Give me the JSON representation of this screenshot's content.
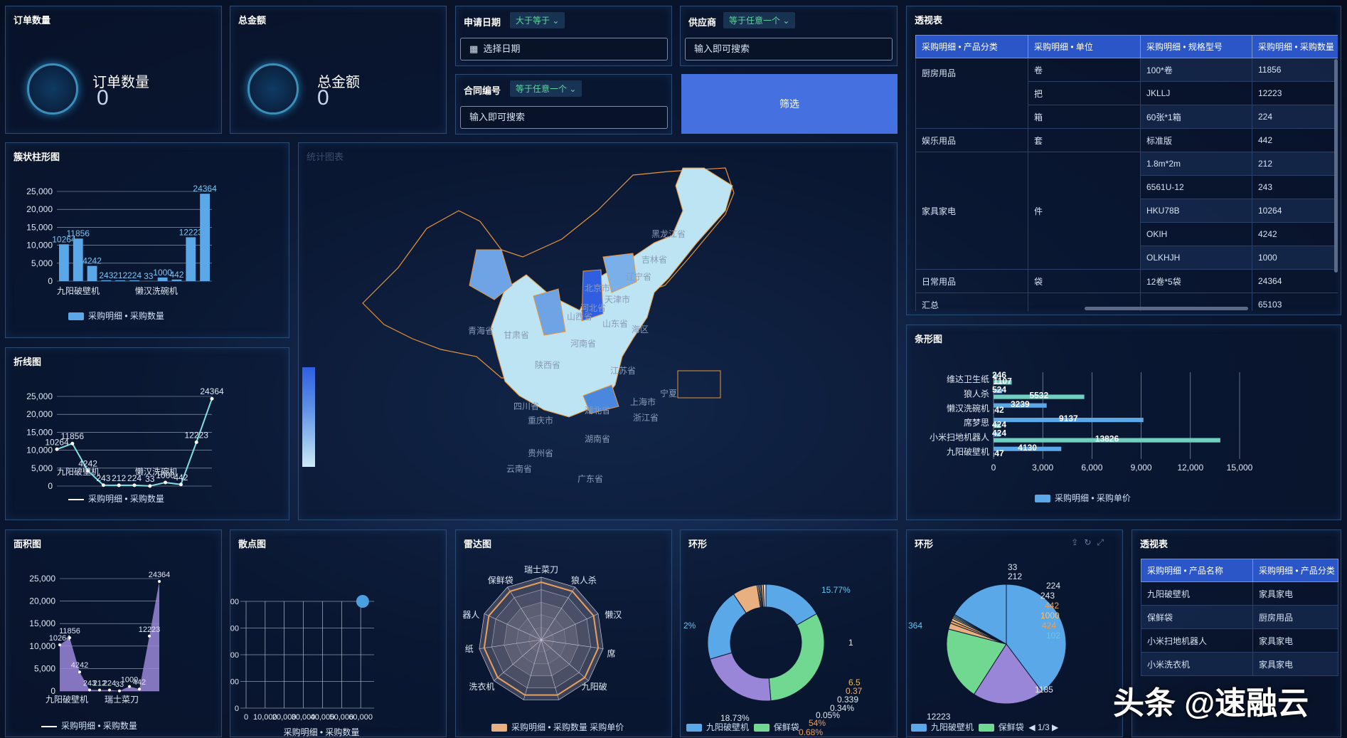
{
  "kpi": [
    {
      "title": "订单数量",
      "label": "订单数量",
      "value": "0"
    },
    {
      "title": "总金额",
      "label": "总金额",
      "value": "0"
    }
  ],
  "filters": {
    "date": {
      "label": "申请日期",
      "condition": "大于等于",
      "placeholder": "选择日期"
    },
    "contract": {
      "label": "合同编号",
      "condition": "等于任意一个",
      "placeholder": "输入即可搜索"
    },
    "supplier": {
      "label": "供应商",
      "condition": "等于任意一个",
      "placeholder": "输入即可搜索"
    },
    "button": "筛选"
  },
  "map": {
    "title": "统计图表",
    "provinces": [
      "黑龙江省",
      "吉林省",
      "辽宁省",
      "北京市",
      "天津市",
      "河北省",
      "山西省",
      "山东省",
      "青海省",
      "甘肃省",
      "陕西省",
      "河南省",
      "江苏省",
      "上海市",
      "四川省",
      "重庆市",
      "湖北省",
      "湖南省",
      "贵州省",
      "云南省",
      "广东省",
      "浙江省",
      "宁夏",
      "海区"
    ]
  },
  "pivot1": {
    "title": "透视表",
    "headers": [
      "采购明细 • 产品分类",
      "采购明细 • 单位",
      "采购明细 • 规格型号",
      "采购明细 • 采购数量"
    ],
    "rows": [
      {
        "cat": "厨房用品",
        "unit": "卷",
        "spec": "100*卷",
        "qty": "11856"
      },
      {
        "cat": "",
        "unit": "把",
        "spec": "JKLLJ",
        "qty": "12223"
      },
      {
        "cat": "",
        "unit": "箱",
        "spec": "60张*1箱",
        "qty": "224"
      },
      {
        "cat": "娱乐用品",
        "unit": "套",
        "spec": "标准版",
        "qty": "442"
      },
      {
        "cat": "家具家电",
        "unit": "件",
        "spec": "1.8m*2m",
        "qty": "212"
      },
      {
        "cat": "",
        "unit": "",
        "spec": "6561U-12",
        "qty": "243"
      },
      {
        "cat": "",
        "unit": "",
        "spec": "HKU78B",
        "qty": "10264"
      },
      {
        "cat": "",
        "unit": "",
        "spec": "OKIH",
        "qty": "4242"
      },
      {
        "cat": "",
        "unit": "",
        "spec": "OLKHJH",
        "qty": "1000"
      },
      {
        "cat": "日常用品",
        "unit": "袋",
        "spec": "12卷*5袋",
        "qty": "24364"
      },
      {
        "cat": "汇总",
        "unit": "",
        "spec": "",
        "qty": "65103"
      }
    ]
  },
  "pivot2": {
    "title": "透视表",
    "headers": [
      "采购明细 • 产品名称",
      "采购明细 • 产品分类"
    ],
    "rows": [
      {
        "name": "九阳破壁机",
        "cat": "家具家电"
      },
      {
        "name": "保鲜袋",
        "cat": "厨房用品"
      },
      {
        "name": "小米扫地机器人",
        "cat": "家具家电"
      },
      {
        "name": "小米洗衣机",
        "cat": "家具家电"
      }
    ]
  },
  "watermark": "头条 @速融云",
  "chart_data": [
    {
      "id": "bar",
      "type": "bar",
      "title": "簇状柱形图",
      "values": [
        10264,
        11856,
        4242,
        243,
        212,
        224,
        33,
        1000,
        442,
        12223,
        24364
      ],
      "data_labels": [
        "10264",
        "11856",
        "4242",
        "243",
        "212",
        "224",
        "33",
        "1000",
        "442",
        "12223",
        "24364"
      ],
      "tick_labels": [
        "九阳破壁机",
        "懒汉洗碗机"
      ],
      "yticks": [
        "25,000",
        "20,000",
        "15,000",
        "10,000",
        "5,000",
        "0"
      ],
      "ylim": [
        0,
        25000
      ],
      "legend": "采购明细 • 采购数量",
      "color": "#5aa8e8"
    },
    {
      "id": "line",
      "type": "line",
      "title": "折线图",
      "values": [
        10264,
        11856,
        4242,
        243,
        212,
        224,
        33,
        1000,
        442,
        12223,
        24364
      ],
      "data_labels": [
        "10264",
        "11856",
        "4242",
        "243",
        "212",
        "224",
        "33",
        "1000",
        "442",
        "12223",
        "24364"
      ],
      "tick_labels": [
        "九阳破壁机",
        "懒汉洗碗机"
      ],
      "yticks": [
        "25,000",
        "20,000",
        "15,000",
        "10,000",
        "5,000",
        "0"
      ],
      "ylim": [
        0,
        25000
      ],
      "legend": "采购明细 • 采购数量",
      "color": "#7ee0e0"
    },
    {
      "id": "area",
      "type": "area",
      "title": "面积图",
      "values": [
        10264,
        11856,
        4242,
        243,
        212,
        224,
        33,
        1000,
        442,
        12223,
        24364
      ],
      "data_labels": [
        "10264",
        "11856",
        "4242",
        "243",
        "212",
        "224",
        "33",
        "1000",
        "442",
        "12223",
        "24364"
      ],
      "tick_labels": [
        "九阳破壁机",
        "瑞士菜刀"
      ],
      "yticks": [
        "25,000",
        "20,000",
        "15,000",
        "10,000",
        "5,000",
        "0"
      ],
      "ylim": [
        0,
        25000
      ],
      "legend": "采购明细 • 采购数量",
      "color": "#9a86d8"
    },
    {
      "id": "hbar",
      "type": "bar",
      "title": "条形图",
      "orientation": "horizontal",
      "categories": [
        "维达卫生纸",
        "狼人杀",
        "懒汉洗碗机",
        "席梦思",
        "小米扫地机器人",
        "九阳破壁机"
      ],
      "series": [
        {
          "name": "采购明细 • 采购单价",
          "color": "#5aa8e8",
          "values": [
            246,
            524,
            3239,
            9137,
            424,
            4130
          ]
        },
        {
          "color": "#6fd0c0",
          "values": [
            1107,
            5532,
            42,
            424,
            13826,
            47
          ]
        }
      ],
      "xticks": [
        "0",
        "3,000",
        "6,000",
        "9,000",
        "12,000",
        "15,000"
      ],
      "xlim": [
        0,
        15000
      ],
      "legend": "采购明细 • 采购单价"
    },
    {
      "id": "scatter",
      "type": "scatter",
      "title": "散点图",
      "xticks": [
        "0",
        "10,000",
        "20,000",
        "30,000",
        "40,000",
        "50,000",
        "60,000"
      ],
      "yticks": [
        "000",
        "000",
        "000",
        "000",
        "0"
      ],
      "points": [
        [
          64000,
          1
        ]
      ],
      "xlabel": "采购明细 • 采购数量"
    },
    {
      "id": "radar",
      "type": "radar",
      "title": "雷达图",
      "axes": [
        "瑞士菜刀",
        "狼人杀",
        "懒汉",
        "席",
        "九阳破",
        "洗衣机",
        "纸",
        "器人",
        "保鲜袋"
      ],
      "legend": [
        "采购明细 • 采购数量",
        "采购单价"
      ]
    },
    {
      "id": "ring1",
      "type": "pie",
      "title": "环形",
      "values": [
        15.77,
        30.0,
        20.5,
        19.0,
        6.5,
        0.37,
        0.339,
        0.34,
        0.05,
        0.54,
        0.68
      ],
      "labels": [
        "15.77%",
        "1",
        "6.5",
        "0.37",
        "0.339",
        "0.34%",
        "0.05%",
        "54%",
        "0.68%",
        "2%",
        "18.73%"
      ],
      "legend": [
        "九阳破壁机",
        "保鲜袋"
      ]
    },
    {
      "id": "ring2",
      "type": "pie",
      "title": "环形",
      "values": [
        24364,
        11856,
        12223,
        1000,
        442,
        424,
        243,
        224,
        212,
        33,
        10264
      ],
      "labels": [
        "33",
        "212",
        "224",
        "243",
        "442",
        "1000",
        "424",
        "102",
        "1185",
        "12223",
        "364"
      ],
      "legend": [
        "九阳破壁机",
        "保鲜袋"
      ],
      "pager": "1/3"
    }
  ]
}
